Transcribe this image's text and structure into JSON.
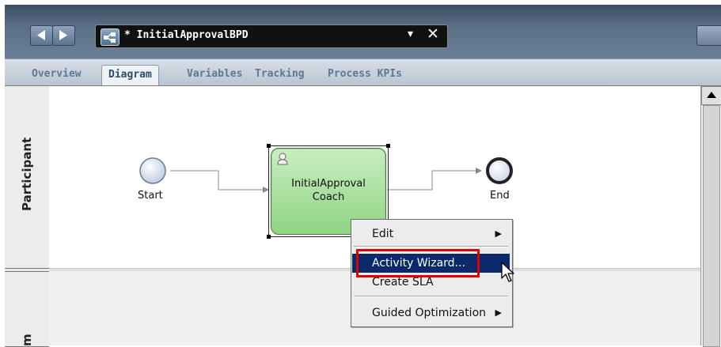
{
  "toolbar": {
    "document_title": "* InitialApprovalBPD",
    "dropdown_glyph": "▾",
    "close_glyph": "✕"
  },
  "tabs": [
    {
      "label": "Overview",
      "active": false
    },
    {
      "label": "Diagram",
      "active": true
    },
    {
      "label": "Variables",
      "active": false
    },
    {
      "label": "Tracking",
      "active": false
    },
    {
      "label": "Process KPIs",
      "active": false
    }
  ],
  "lanes": [
    {
      "label": "Participant"
    },
    {
      "label": "m"
    }
  ],
  "diagram": {
    "start_label": "Start",
    "end_label": "End",
    "task_label_line1": "InitialApproval",
    "task_label_line2": "Coach",
    "task_icon": "user-icon"
  },
  "context_menu": {
    "items": [
      {
        "label": "Edit",
        "submenu": true
      },
      {
        "label": "Activity Wizard...",
        "submenu": false,
        "highlighted": true
      },
      {
        "label": "Create SLA",
        "submenu": false
      },
      {
        "label": "Guided Optimization",
        "submenu": true
      }
    ]
  },
  "colors": {
    "task_fill": "#8fd483",
    "menu_highlight": "#0a2a6b",
    "annotation_red": "#e00000"
  }
}
